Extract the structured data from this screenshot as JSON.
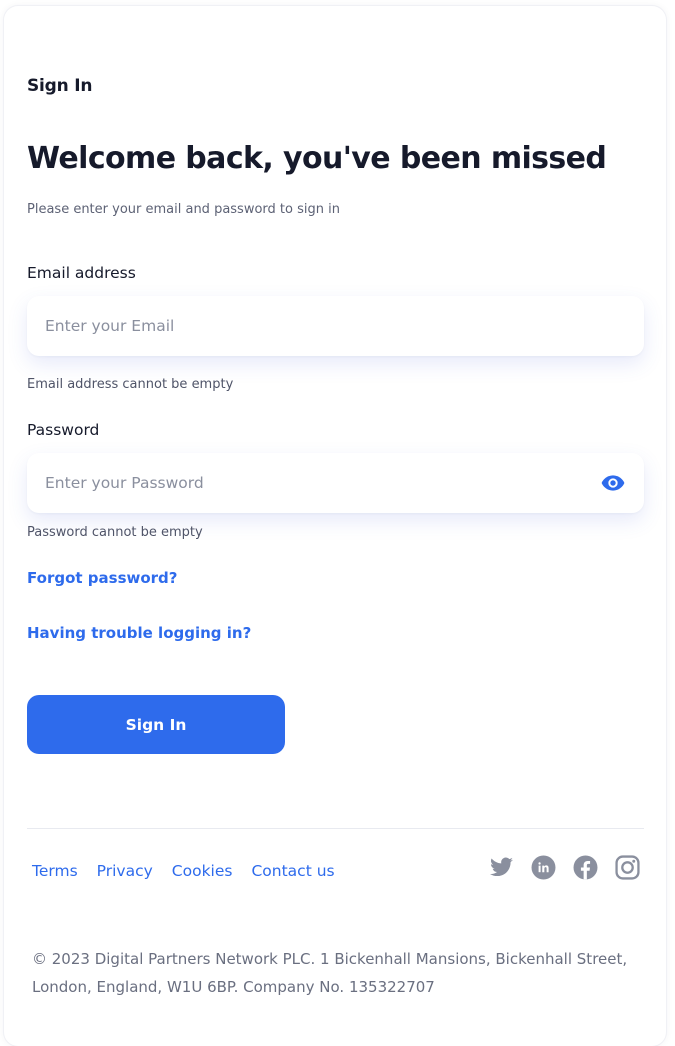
{
  "page": {
    "breadcrumb": "Sign In",
    "title": "Welcome back, you've been missed",
    "subtitle": "Please enter your email and password to sign in"
  },
  "form": {
    "email": {
      "label": "Email address",
      "placeholder": "Enter your Email",
      "value": "",
      "error": "Email address cannot be empty"
    },
    "password": {
      "label": "Password",
      "placeholder": "Enter your Password",
      "value": "",
      "error": "Password cannot be empty",
      "toggle_icon": "eye-icon"
    },
    "forgot_link": "Forgot password?",
    "trouble_link": "Having trouble logging in?",
    "submit_label": "Sign In"
  },
  "footer": {
    "links": [
      "Terms",
      "Privacy",
      "Cookies",
      "Contact us"
    ],
    "socials": [
      "twitter-icon",
      "linkedin-icon",
      "facebook-icon",
      "instagram-icon"
    ],
    "copyright": "© 2023 Digital Partners Network PLC. 1 Bickenhall Mansions, Bickenhall Street, London, England, W1U 6BP. Company No. 135322707"
  },
  "colors": {
    "accent": "#2e6bec",
    "heading": "#161a2b",
    "muted": "#5d6275",
    "social_icon": "#8a8f9e"
  }
}
